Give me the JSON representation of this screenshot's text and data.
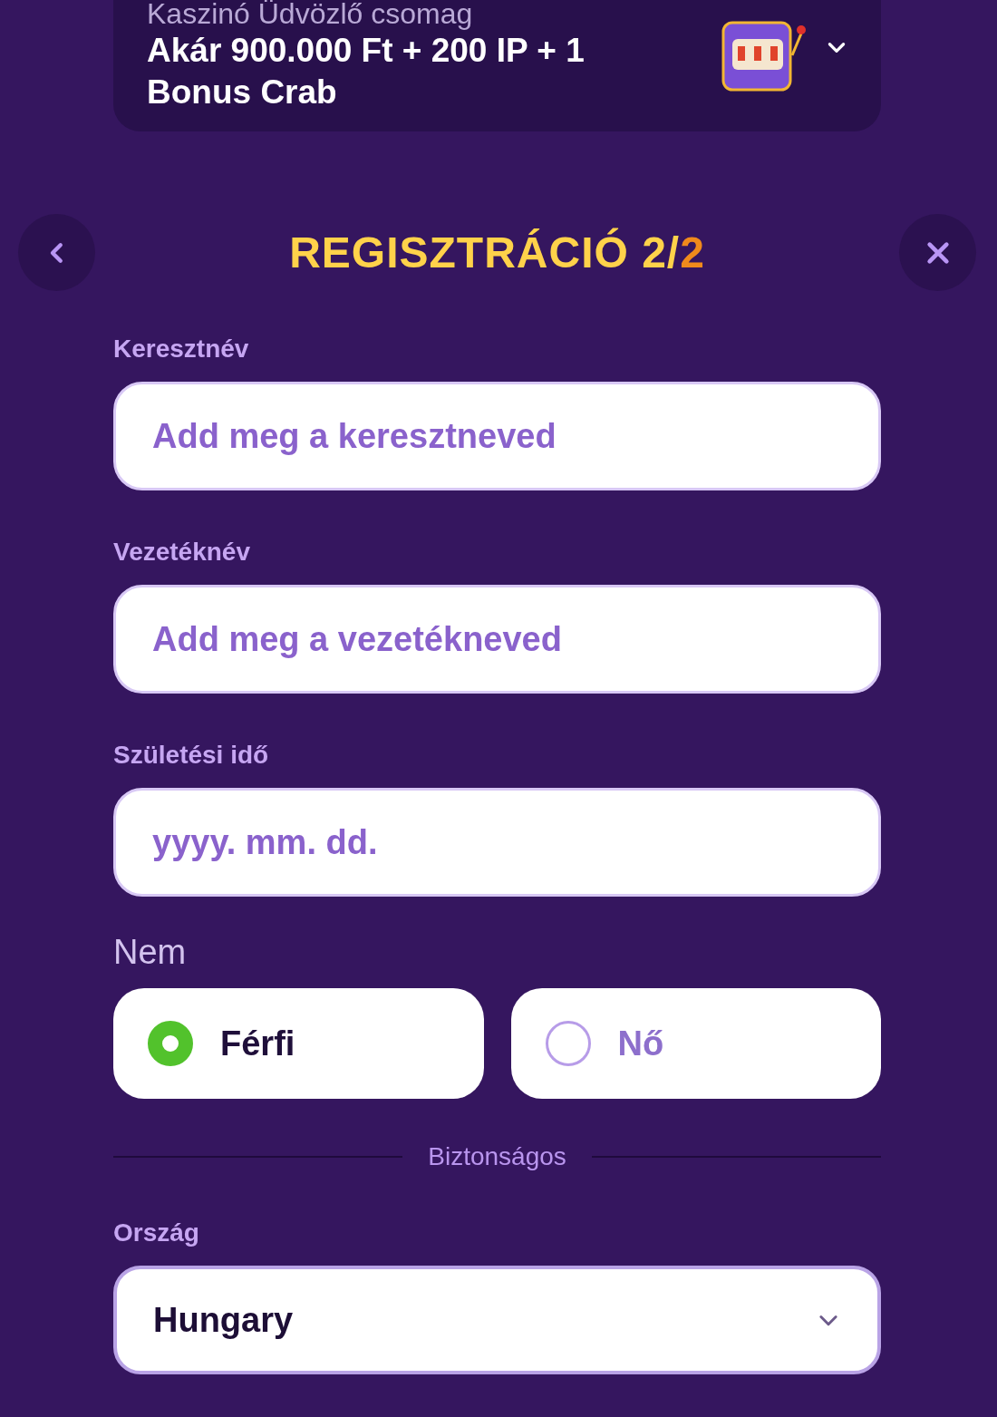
{
  "promo": {
    "subtitle": "Kaszinó Üdvözlő csomag",
    "title": "Akár 900.000 Ft + 200 IP + 1 Bonus Crab"
  },
  "header": {
    "title": "REGISZTRÁCIÓ 2/",
    "title_accent": "2"
  },
  "fields": [
    {
      "label": "Keresztnév",
      "placeholder": "Add meg a keresztneved"
    },
    {
      "label": "Vezetéknév",
      "placeholder": "Add meg a vezetékneved"
    },
    {
      "label": "Születési idő",
      "placeholder": "yyyy. mm. dd."
    }
  ],
  "gender": {
    "label": "Nem",
    "options": [
      {
        "label": "Férfi",
        "selected": true
      },
      {
        "label": "Nő",
        "selected": false
      }
    ]
  },
  "divider": "Biztonságos",
  "country": {
    "label": "Ország",
    "value": "Hungary"
  }
}
